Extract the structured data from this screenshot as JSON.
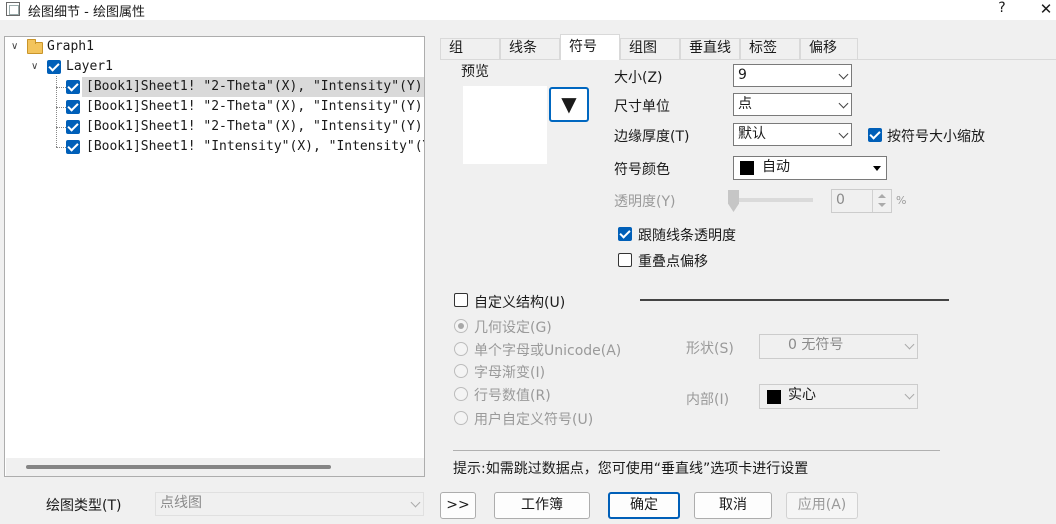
{
  "window": {
    "title": "绘图细节 - 绘图属性",
    "help_label": "?",
    "close_label": "✕",
    "app_icon": "window-icon"
  },
  "tree": {
    "root": "Graph1",
    "layer": "Layer1",
    "plots": [
      "[Book1]Sheet1! \"2-Theta\"(X), \"Intensity\"(Y)",
      "[Book1]Sheet1! \"2-Theta\"(X), \"Intensity\"(Y)",
      "[Book1]Sheet1! \"2-Theta\"(X), \"Intensity\"(Y)",
      "[Book1]Sheet1! \"Intensity\"(X), \"Intensity\"(Y)"
    ]
  },
  "tabs": [
    "组",
    "线条",
    "符号",
    "组图",
    "垂直线",
    "标签",
    "偏移"
  ],
  "active_tab": "符号",
  "symbol": {
    "preview_label": "预览",
    "preview_symbol": "▼",
    "size_label": "大小(Z)",
    "size_value": "9",
    "unit_label": "尺寸单位",
    "unit_value": "点",
    "edge_label": "边缘厚度(T)",
    "edge_value": "默认",
    "scale_label": "按符号大小缩放",
    "color_label": "符号颜色",
    "color_value": "自动",
    "transparency_label": "透明度(Y)",
    "transparency_value": "0",
    "transparency_unit": "%",
    "follow_line_label": "跟随线条透明度",
    "overlap_label": "重叠点偏移",
    "custom_label": "自定义结构(U)",
    "radio_options": [
      "几何设定(G)",
      "单个字母或Unicode(A)",
      "字母渐变(I)",
      "行号数值(R)",
      "用户自定义符号(U)"
    ],
    "shape_label": "形状(S)",
    "shape_value": "0 无符号",
    "interior_label": "内部(I)",
    "interior_value": "实心",
    "hint": "提示:如需跳过数据点，您可使用“垂直线”选项卡进行设置"
  },
  "footer": {
    "plot_type_label": "绘图类型(T)",
    "plot_type_value": "点线图",
    "expand_label": ">>",
    "workbook_label": "工作簿",
    "ok_label": "确定",
    "cancel_label": "取消",
    "apply_label": "应用(A)"
  },
  "colors": {
    "accent": "#005fb8",
    "checkbox_checked": "#005fb8",
    "swatch": "#000000"
  },
  "state": {
    "transparency": 0,
    "scale_checked": true,
    "follow_line_checked": true,
    "overlap_checked": false,
    "custom_checked": false,
    "selected_radio": 0
  }
}
